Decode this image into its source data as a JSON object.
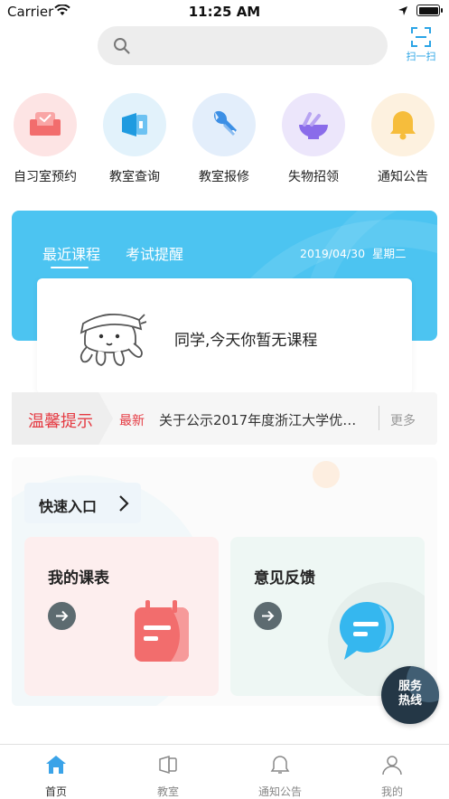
{
  "status_bar": {
    "carrier": "Carrier",
    "time": "11:25 AM"
  },
  "search": {
    "placeholder": ""
  },
  "scan": {
    "label": "扫一扫"
  },
  "quick_actions": [
    {
      "label": "自习室预约",
      "icon": "armchair-icon",
      "color": "#fde4e4"
    },
    {
      "label": "教室查询",
      "icon": "projector-icon",
      "color": "#e2f2fb"
    },
    {
      "label": "教室报修",
      "icon": "wrench-icon",
      "color": "#e3eefb"
    },
    {
      "label": "失物招领",
      "icon": "basin-icon",
      "color": "#ece6fb"
    },
    {
      "label": "通知公告",
      "icon": "bell-icon",
      "color": "#fdf1df"
    }
  ],
  "course": {
    "tabs": [
      "最近课程",
      "考试提醒"
    ],
    "active_tab": 0,
    "date": "2019/04/30",
    "weekday": "星期二",
    "empty_message": "同学,今天你暂无课程"
  },
  "notice": {
    "title": "温馨提示",
    "badge": "最新",
    "text": "关于公示2017年度浙江大学优秀学生...",
    "more": "更多"
  },
  "quick_entry": {
    "title": "快速入口",
    "cards": [
      {
        "title": "我的课表",
        "icon": "calendar-icon"
      },
      {
        "title": "意见反馈",
        "icon": "chat-bubble-icon"
      }
    ]
  },
  "hotline": {
    "line1": "服务",
    "line2": "热线"
  },
  "tabbar": [
    {
      "label": "首页",
      "active": true
    },
    {
      "label": "教室",
      "active": false
    },
    {
      "label": "通知公告",
      "active": false
    },
    {
      "label": "我的",
      "active": false
    }
  ],
  "colors": {
    "accent": "#4cc4f1",
    "alert_red": "#e53b43",
    "link_blue": "#2aa4e6"
  }
}
